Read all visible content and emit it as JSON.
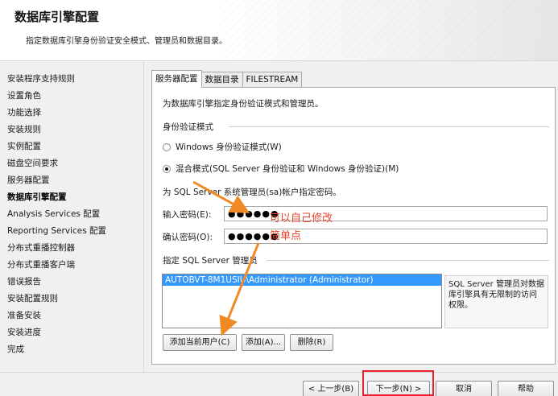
{
  "header": {
    "title": "数据库引擎配置",
    "subtitle": "指定数据库引擎身份验证安全模式、管理员和数据目录。"
  },
  "sidebar": {
    "items": [
      {
        "label": "安装程序支持规则",
        "active": false
      },
      {
        "label": "设置角色",
        "active": false
      },
      {
        "label": "功能选择",
        "active": false
      },
      {
        "label": "安装规则",
        "active": false
      },
      {
        "label": "实例配置",
        "active": false
      },
      {
        "label": "磁盘空间要求",
        "active": false
      },
      {
        "label": "服务器配置",
        "active": false
      },
      {
        "label": "数据库引擎配置",
        "active": true
      },
      {
        "label": "Analysis Services 配置",
        "active": false
      },
      {
        "label": "Reporting Services 配置",
        "active": false
      },
      {
        "label": "分布式重播控制器",
        "active": false
      },
      {
        "label": "分布式重播客户端",
        "active": false
      },
      {
        "label": "错误报告",
        "active": false
      },
      {
        "label": "安装配置规则",
        "active": false
      },
      {
        "label": "准备安装",
        "active": false
      },
      {
        "label": "安装进度",
        "active": false
      },
      {
        "label": "完成",
        "active": false
      }
    ]
  },
  "tabs": [
    {
      "label": "服务器配置",
      "active": true
    },
    {
      "label": "数据目录",
      "active": false
    },
    {
      "label": "FILESTREAM",
      "active": false
    }
  ],
  "server_config": {
    "description": "为数据库引擎指定身份验证模式和管理员。",
    "auth_group_title": "身份验证模式",
    "windows_auth_label": "Windows 身份验证模式(W)",
    "mixed_auth_label": "混合模式(SQL Server 身份验证和 Windows 身份验证)(M)",
    "selected_mode": "mixed",
    "sa_title": "为 SQL Server 系统管理员(sa)帐户指定密码。",
    "password_label": "输入密码(E):",
    "password_value": "●●●●●●",
    "confirm_label": "确认密码(O):",
    "confirm_value": "●●●●●●",
    "admins_title": "指定 SQL Server 管理员",
    "admins": [
      "AUTOBVT-8M1USIU\\Administrator (Administrator)"
    ],
    "admins_note": "SQL Server 管理员对数据库引擎具有无限制的访问权限。",
    "add_current_user_label": "添加当前用户(C)",
    "add_label": "添加(A)...",
    "remove_label": "删除(R)"
  },
  "footer": {
    "back_label": "< 上一步(B)",
    "next_label": "下一步(N) >",
    "cancel_label": "取消",
    "help_label": "帮助"
  },
  "annotations": {
    "note_line1": "可以自己修改",
    "note_line2": "简单点",
    "color": "#e8432a",
    "highlight_color": "#e8202a"
  }
}
